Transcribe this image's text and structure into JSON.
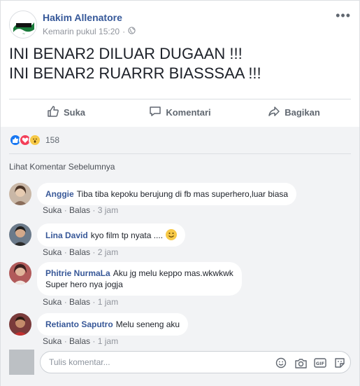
{
  "post": {
    "author": "Hakim Allenatore",
    "timestamp": "Kemarin pukul 15:20",
    "more": "•••",
    "lines": [
      "INI BENAR2 DILUAR DUGAAN !!!",
      "INI BENAR2 RUARRR BIASSSAA !!!"
    ]
  },
  "actions": {
    "like": "Suka",
    "comment": "Komentari",
    "share": "Bagikan"
  },
  "reactions": {
    "count": "158"
  },
  "previous_comments": "Lihat Komentar Sebelumnya",
  "comments": [
    {
      "name": "Anggie",
      "text": "Tiba tiba kepoku berujung di fb mas superhero,luar biasa",
      "like": "Suka",
      "reply": "Balas",
      "time": "3 jam"
    },
    {
      "name": "Lina David",
      "text": "kyo film tp nyata ....",
      "like": "Suka",
      "reply": "Balas",
      "time": "2 jam"
    },
    {
      "name": "Phitrie NurmaLa",
      "text": "Aku jg melu keppo mas.wkwkwk",
      "text2": "Super hero nya jogja",
      "like": "Suka",
      "reply": "Balas",
      "time": "1 jam"
    },
    {
      "name": "Retianto Saputro",
      "text": "Melu seneng aku",
      "like": "Suka",
      "reply": "Balas",
      "time": "1 jam"
    }
  ],
  "compose": {
    "placeholder": "Tulis komentar..."
  },
  "colors": {
    "link": "#365899",
    "muted": "#90949c",
    "bg": "#f2f3f5"
  }
}
